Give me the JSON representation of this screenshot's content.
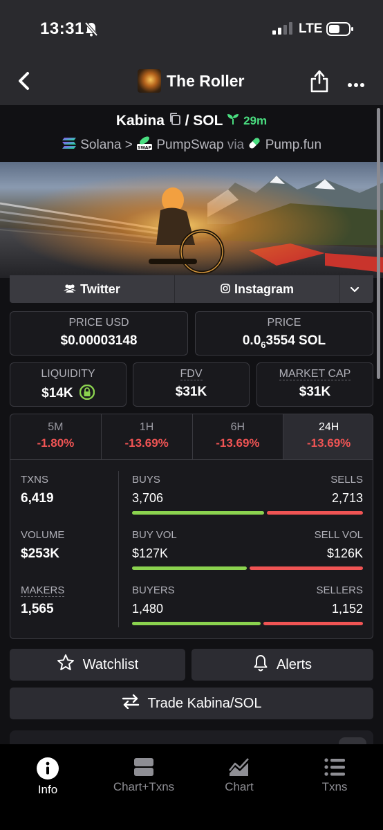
{
  "status_bar": {
    "time": "13:31",
    "network": "LTE"
  },
  "header": {
    "title": "The Roller"
  },
  "pair": {
    "base": "Kabina",
    "separator": "/",
    "quote": "SOL",
    "age": "29m"
  },
  "chain": {
    "network": "Solana",
    "separator": ">",
    "dex": "PumpSwap",
    "via": "via",
    "launchpad": "Pump.fun",
    "dex_badge": "SWAP"
  },
  "socials": {
    "twitter": "Twitter",
    "instagram": "Instagram"
  },
  "price": {
    "usd_label": "PRICE USD",
    "usd_value": "$0.00003148",
    "native_label": "PRICE",
    "native_prefix": "0.0",
    "native_zeros": "6",
    "native_digits": "3554 SOL"
  },
  "metrics": {
    "liquidity_label": "LIQUIDITY",
    "liquidity_value": "$14K",
    "fdv_label": "FDV",
    "fdv_value": "$31K",
    "mcap_label": "MARKET CAP",
    "mcap_value": "$31K"
  },
  "timeframes": [
    {
      "label": "5M",
      "change": "-1.80%"
    },
    {
      "label": "1H",
      "change": "-13.69%"
    },
    {
      "label": "6H",
      "change": "-13.69%"
    },
    {
      "label": "24H",
      "change": "-13.69%"
    }
  ],
  "stats": {
    "txns_label": "TXNS",
    "txns_value": "6,419",
    "volume_label": "VOLUME",
    "volume_value": "$253K",
    "makers_label": "MAKERS",
    "makers_value": "1,565",
    "buys_label": "BUYS",
    "buys_value": "3,706",
    "sells_label": "SELLS",
    "sells_value": "2,713",
    "buyvol_label": "BUY VOL",
    "buyvol_value": "$127K",
    "sellvol_label": "SELL VOL",
    "sellvol_value": "$126K",
    "buyers_label": "BUYERS",
    "buyers_value": "1,480",
    "sellers_label": "SELLERS",
    "sellers_value": "1,152",
    "buy_share": 0.577,
    "buyvol_share": 0.502,
    "buyers_share": 0.562
  },
  "actions": {
    "watchlist": "Watchlist",
    "alerts": "Alerts",
    "trade": "Trade Kabina/SOL"
  },
  "nav": {
    "info": "Info",
    "chart_txns": "Chart+Txns",
    "chart": "Chart",
    "txns": "Txns"
  },
  "colors": {
    "positive": "#8bd34f",
    "negative": "#f05454",
    "age": "#4ade80"
  }
}
